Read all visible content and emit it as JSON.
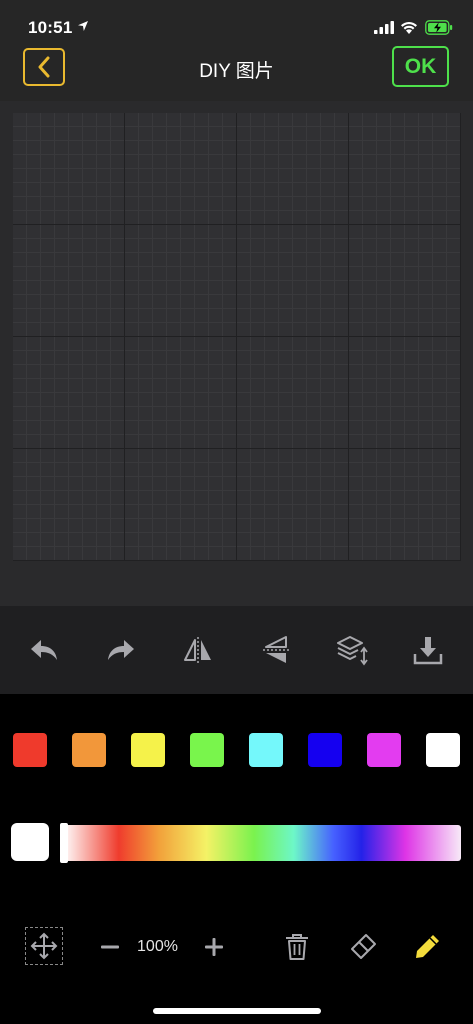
{
  "status_bar": {
    "time": "10:51"
  },
  "header": {
    "title": "DIY 图片",
    "ok_label": "OK"
  },
  "toolbar": {
    "icons": [
      "undo-icon",
      "redo-icon",
      "flip-horizontal-icon",
      "flip-vertical-icon",
      "layers-icon",
      "download-icon"
    ]
  },
  "palette": {
    "colors": [
      "#ef3a2c",
      "#f2973a",
      "#f5f24a",
      "#79f54c",
      "#74f8fb",
      "#1500f0",
      "#e33cf0",
      "#ffffff"
    ]
  },
  "color_picker": {
    "current_color": "#ffffff",
    "hue_position": 0
  },
  "bottom_bar": {
    "zoom_level": "100%"
  },
  "accent": {
    "back": "#e9b92f",
    "ok": "#4ee04b",
    "pencil": "#f4dc3c"
  }
}
